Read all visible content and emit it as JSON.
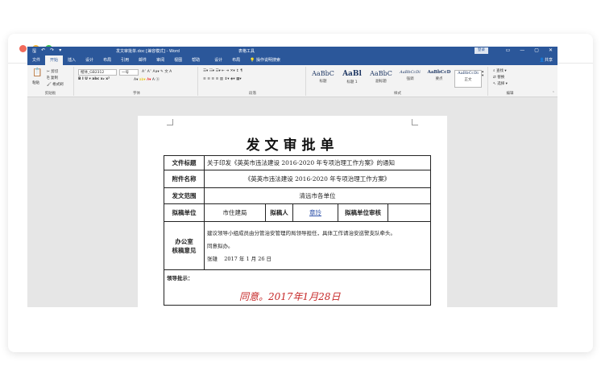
{
  "window": {
    "doc_title": "发文审批单.doc [兼容模式] - Word",
    "tools_title": "表格工具",
    "login": "登录",
    "qat_save": "🖫",
    "qat_undo": "↶",
    "qat_redo": "↷",
    "qat_more": "▾",
    "min": "—",
    "max": "▢",
    "close": "✕",
    "ribbon_opts": "▭"
  },
  "tabs": [
    "文件",
    "开始",
    "插入",
    "设计",
    "布局",
    "引用",
    "邮件",
    "审阅",
    "视图",
    "帮助",
    "设计",
    "布局"
  ],
  "tell_me": "操作说明搜索",
  "share": "共享",
  "ribbon": {
    "clipboard": {
      "paste": "粘贴",
      "cut": "剪切",
      "copy": "复制",
      "format_painter": "格式刷",
      "label": "剪贴板"
    },
    "font": {
      "name": "楷体_GB2312",
      "size": "一号",
      "label": "字体"
    },
    "paragraph": {
      "label": "段落"
    },
    "styles": {
      "label": "样式",
      "items": [
        {
          "sample": "AaBbC",
          "name": "标题"
        },
        {
          "sample": "AaBl",
          "name": "标题 1"
        },
        {
          "sample": "AaBbC",
          "name": "副标题"
        },
        {
          "sample": "AaBbCcDi",
          "name": "强调"
        },
        {
          "sample": "AaBbCcD",
          "name": "要点"
        },
        {
          "sample": "AaBbCcDi",
          "name": "正文"
        }
      ]
    },
    "editing": {
      "find": "查找",
      "replace": "替换",
      "select": "选择",
      "label": "编辑"
    }
  },
  "document": {
    "heading": "发文审批单",
    "rows": {
      "title_label": "文件标题",
      "title_value": "关于印发《英英市违法建设 2016-2020 年专项治理工作方案》的通知",
      "attach_label": "附件名称",
      "attach_value": "《英英市违法建设 2016-2020 年专项治理工作方案》",
      "scope_label": "发文范围",
      "scope_value": "清远市各单位",
      "draft_unit_label": "拟稿单位",
      "draft_unit_value": "市住建局",
      "drafter_label": "拟稿人",
      "drafter_value": "章玲",
      "review_label": "拟稿单位审核",
      "review_value": "",
      "opinion_label_1": "办公室",
      "opinion_label_2": "核稿意见",
      "opinion_line_1": "建议领导小组成员由分管治安管理的局领导担任，具体工作请治安巡警支队牵头。",
      "opinion_line_2": "同意拟办。",
      "opinion_sign": "张雄",
      "opinion_date": "2017 年 1 月 26 日",
      "leader_label": "领导批示："
    },
    "signature": "同意。2017年1月28日"
  }
}
